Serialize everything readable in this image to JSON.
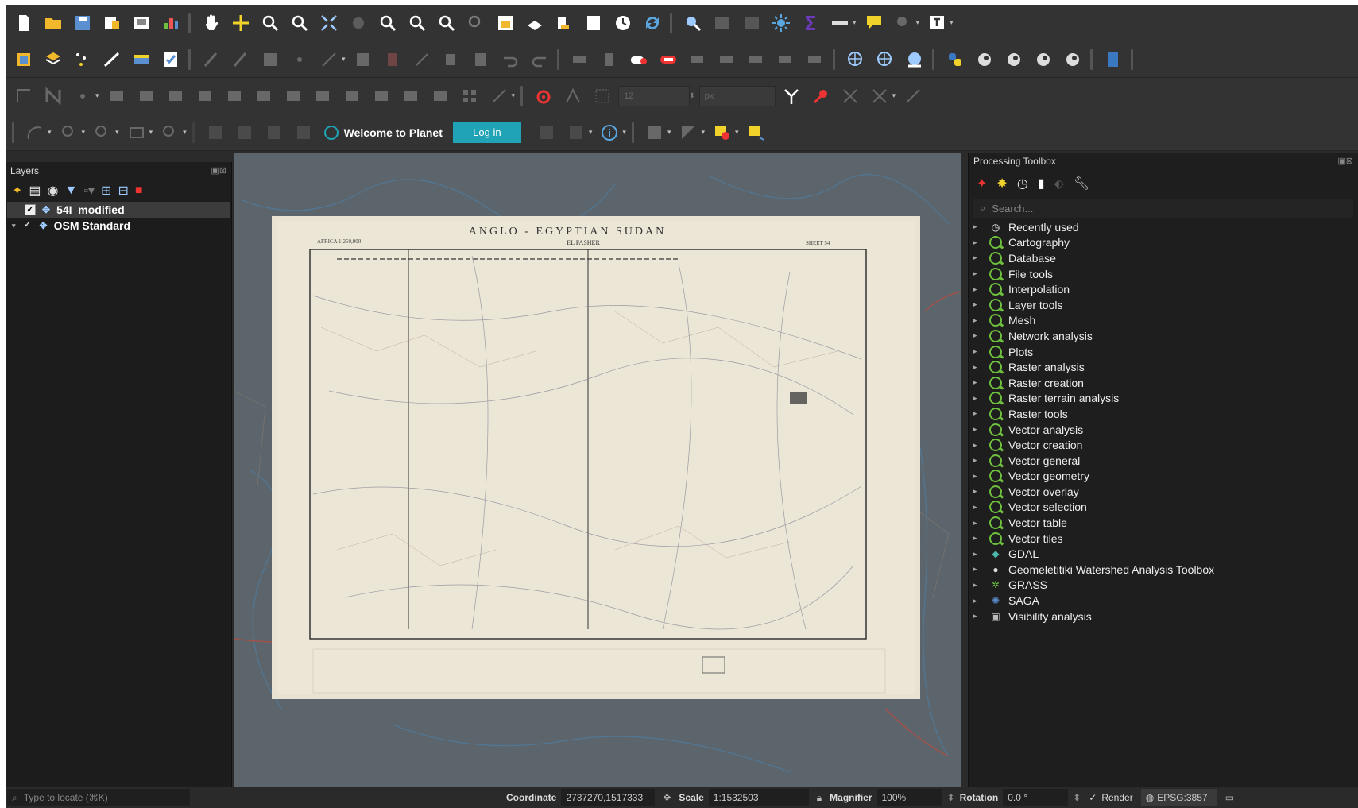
{
  "planet": {
    "welcome": "Welcome to Planet",
    "login_label": "Log in"
  },
  "digitize": {
    "snap_value": "12",
    "snap_unit": "px"
  },
  "layers_panel": {
    "title": "Layers",
    "items": [
      {
        "label": "54I_modified",
        "checked": true
      },
      {
        "label": "OSM Standard",
        "checked": true
      }
    ]
  },
  "map": {
    "title": "ANGLO - EGYPTIAN SUDAN",
    "subtitle": "EL FASHER",
    "scale_note": "AFRICA 1:250,000",
    "sheet": "SHEET 54"
  },
  "toolbox": {
    "title": "Processing Toolbox",
    "search_placeholder": "Search...",
    "groups": [
      {
        "label": "Recently used",
        "icon": "clock-icon"
      },
      {
        "label": "Cartography",
        "icon": "qgis-icon"
      },
      {
        "label": "Database",
        "icon": "qgis-icon"
      },
      {
        "label": "File tools",
        "icon": "qgis-icon"
      },
      {
        "label": "Interpolation",
        "icon": "qgis-icon"
      },
      {
        "label": "Layer tools",
        "icon": "qgis-icon"
      },
      {
        "label": "Mesh",
        "icon": "qgis-icon"
      },
      {
        "label": "Network analysis",
        "icon": "qgis-icon"
      },
      {
        "label": "Plots",
        "icon": "qgis-icon"
      },
      {
        "label": "Raster analysis",
        "icon": "qgis-icon"
      },
      {
        "label": "Raster creation",
        "icon": "qgis-icon"
      },
      {
        "label": "Raster terrain analysis",
        "icon": "qgis-icon"
      },
      {
        "label": "Raster tools",
        "icon": "qgis-icon"
      },
      {
        "label": "Vector analysis",
        "icon": "qgis-icon"
      },
      {
        "label": "Vector creation",
        "icon": "qgis-icon"
      },
      {
        "label": "Vector general",
        "icon": "qgis-icon"
      },
      {
        "label": "Vector geometry",
        "icon": "qgis-icon"
      },
      {
        "label": "Vector overlay",
        "icon": "qgis-icon"
      },
      {
        "label": "Vector selection",
        "icon": "qgis-icon"
      },
      {
        "label": "Vector table",
        "icon": "qgis-icon"
      },
      {
        "label": "Vector tiles",
        "icon": "qgis-icon"
      },
      {
        "label": "GDAL",
        "icon": "gdal-icon"
      },
      {
        "label": "Geomeletitiki Watershed Analysis Toolbox",
        "icon": "globe-icon"
      },
      {
        "label": "GRASS",
        "icon": "grass-icon"
      },
      {
        "label": "SAGA",
        "icon": "saga-icon"
      },
      {
        "label": "Visibility analysis",
        "icon": "visibility-icon"
      }
    ]
  },
  "statusbar": {
    "locate_placeholder": "Type to locate (⌘K)",
    "coordinate_label": "Coordinate",
    "coordinate_value": "2737270,1517333",
    "scale_label": "Scale",
    "scale_value": "1:1532503",
    "magnifier_label": "Magnifier",
    "magnifier_value": "100%",
    "rotation_label": "Rotation",
    "rotation_value": "0.0 °",
    "render_label": "Render",
    "crs_label": "EPSG:3857"
  },
  "colors": {
    "accent_login": "#1fa3b5",
    "qgis_green": "#6fbf3f",
    "map_paper": "#e8e2d2"
  }
}
